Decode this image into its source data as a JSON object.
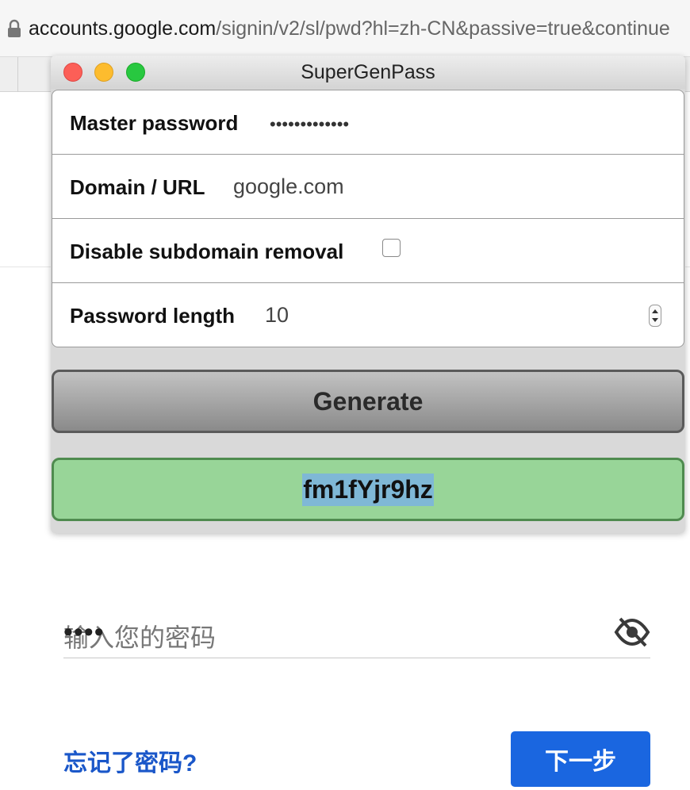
{
  "browser": {
    "url_host": "accounts.google.com",
    "url_path": "/signin/v2/sl/pwd?hl=zh-CN&passive=true&continue"
  },
  "popup": {
    "title": "SuperGenPass",
    "fields": {
      "master_password_label": "Master password",
      "master_password_value": "•••••••••••••",
      "domain_label": "Domain / URL",
      "domain_value": "google.com",
      "subdomain_label": "Disable subdomain removal",
      "subdomain_checked": false,
      "length_label": "Password length",
      "length_value": "10"
    },
    "generate_label": "Generate",
    "generated_password": "fm1fYjr9hz"
  },
  "google": {
    "password_masked": "••••",
    "password_placeholder": "输入您的密码",
    "forgot_label": "忘记了密码?",
    "next_label": "下一步"
  },
  "icons": {
    "lock": "lock-icon",
    "eye": "eye-off-icon"
  }
}
